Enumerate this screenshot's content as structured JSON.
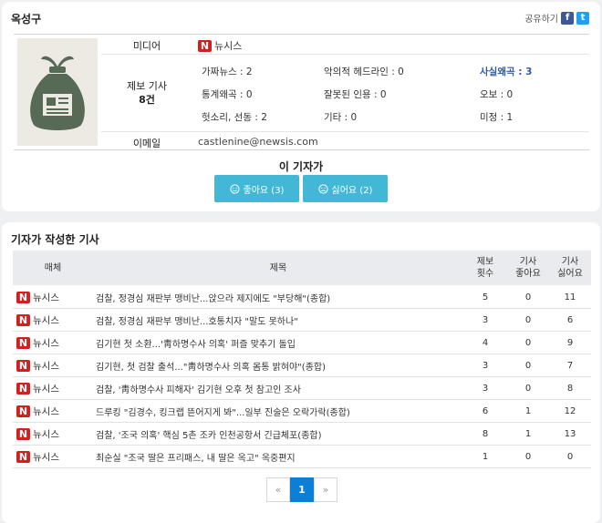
{
  "reporter": {
    "name": "옥성구"
  },
  "share": {
    "label": "공유하기",
    "facebook_glyph": "f",
    "twitter_glyph": "t"
  },
  "profile": {
    "media_label": "미디어",
    "media_name": "뉴시스",
    "report_label": "제보 기사",
    "report_count": "8건",
    "email_label": "이메일",
    "email": "castlenine@newsis.com",
    "categories": [
      {
        "label": "가짜뉴스 : 2"
      },
      {
        "label": "악의적 헤드라인 : 0"
      },
      {
        "label": "사실왜곡 : 3"
      },
      {
        "label": "통계왜곡 : 0"
      },
      {
        "label": "잘못된 인용 : 0"
      },
      {
        "label": "오보 : 0"
      },
      {
        "label": "헛소리, 선동 : 2"
      },
      {
        "label": "기타 : 0"
      },
      {
        "label": "미정 : 1"
      }
    ]
  },
  "reaction": {
    "title": "이 기자가",
    "like_label": "좋아요 (3)",
    "dislike_label": "싫어요 (2)"
  },
  "articles": {
    "section_title": "기자가 작성한 기사",
    "headers": {
      "media": "매체",
      "title": "제목",
      "reports_1": "제보",
      "reports_2": "횟수",
      "likes_1": "기사",
      "likes_2": "좋아요",
      "dislikes_1": "기사",
      "dislikes_2": "싫어요"
    },
    "rows": [
      {
        "media": "뉴시스",
        "title": "검찰, 정경심 재판부 맹비난...앉으라 제지에도 \"부당해\"(종합)",
        "reports": "5",
        "likes": "0",
        "dislikes": "11"
      },
      {
        "media": "뉴시스",
        "title": "검찰, 정경심 재판부 맹비난...호통치자 \"말도 못하나\"",
        "reports": "3",
        "likes": "0",
        "dislikes": "6"
      },
      {
        "media": "뉴시스",
        "title": "김기현 첫 소환...'靑하명수사 의혹' 퍼즐 맞추기 돌입",
        "reports": "4",
        "likes": "0",
        "dislikes": "9"
      },
      {
        "media": "뉴시스",
        "title": "김기현, 첫 검찰 출석...\"靑하명수사 의혹 몸통 밝혀야\"(종합)",
        "reports": "3",
        "likes": "0",
        "dislikes": "7"
      },
      {
        "media": "뉴시스",
        "title": "검찰, '靑하명수사 피해자' 김기현 오후 첫 참고인 조사",
        "reports": "3",
        "likes": "0",
        "dislikes": "8"
      },
      {
        "media": "뉴시스",
        "title": "드루킹 \"김경수, 킹크랩 뜯어지게 봐\"...일부 진술은 오락가락(종합)",
        "reports": "6",
        "likes": "1",
        "dislikes": "12"
      },
      {
        "media": "뉴시스",
        "title": "검찰, '조국 의혹' 핵심 5촌 조카 인천공항서 긴급체포(종합)",
        "reports": "8",
        "likes": "1",
        "dislikes": "13"
      },
      {
        "media": "뉴시스",
        "title": "최순실 \"조국 딸은 프리패스, 내 딸은 옥고\" 옥중편지",
        "reports": "1",
        "likes": "0",
        "dislikes": "0"
      }
    ]
  },
  "pagination": {
    "prev": "«",
    "current": "1",
    "next": "»"
  },
  "colors": {
    "accent_button": "#43b7d6",
    "pager_active": "#0b7fd6",
    "newsis_red": "#d21f1f",
    "highlight_blue": "#2e5aa6"
  }
}
